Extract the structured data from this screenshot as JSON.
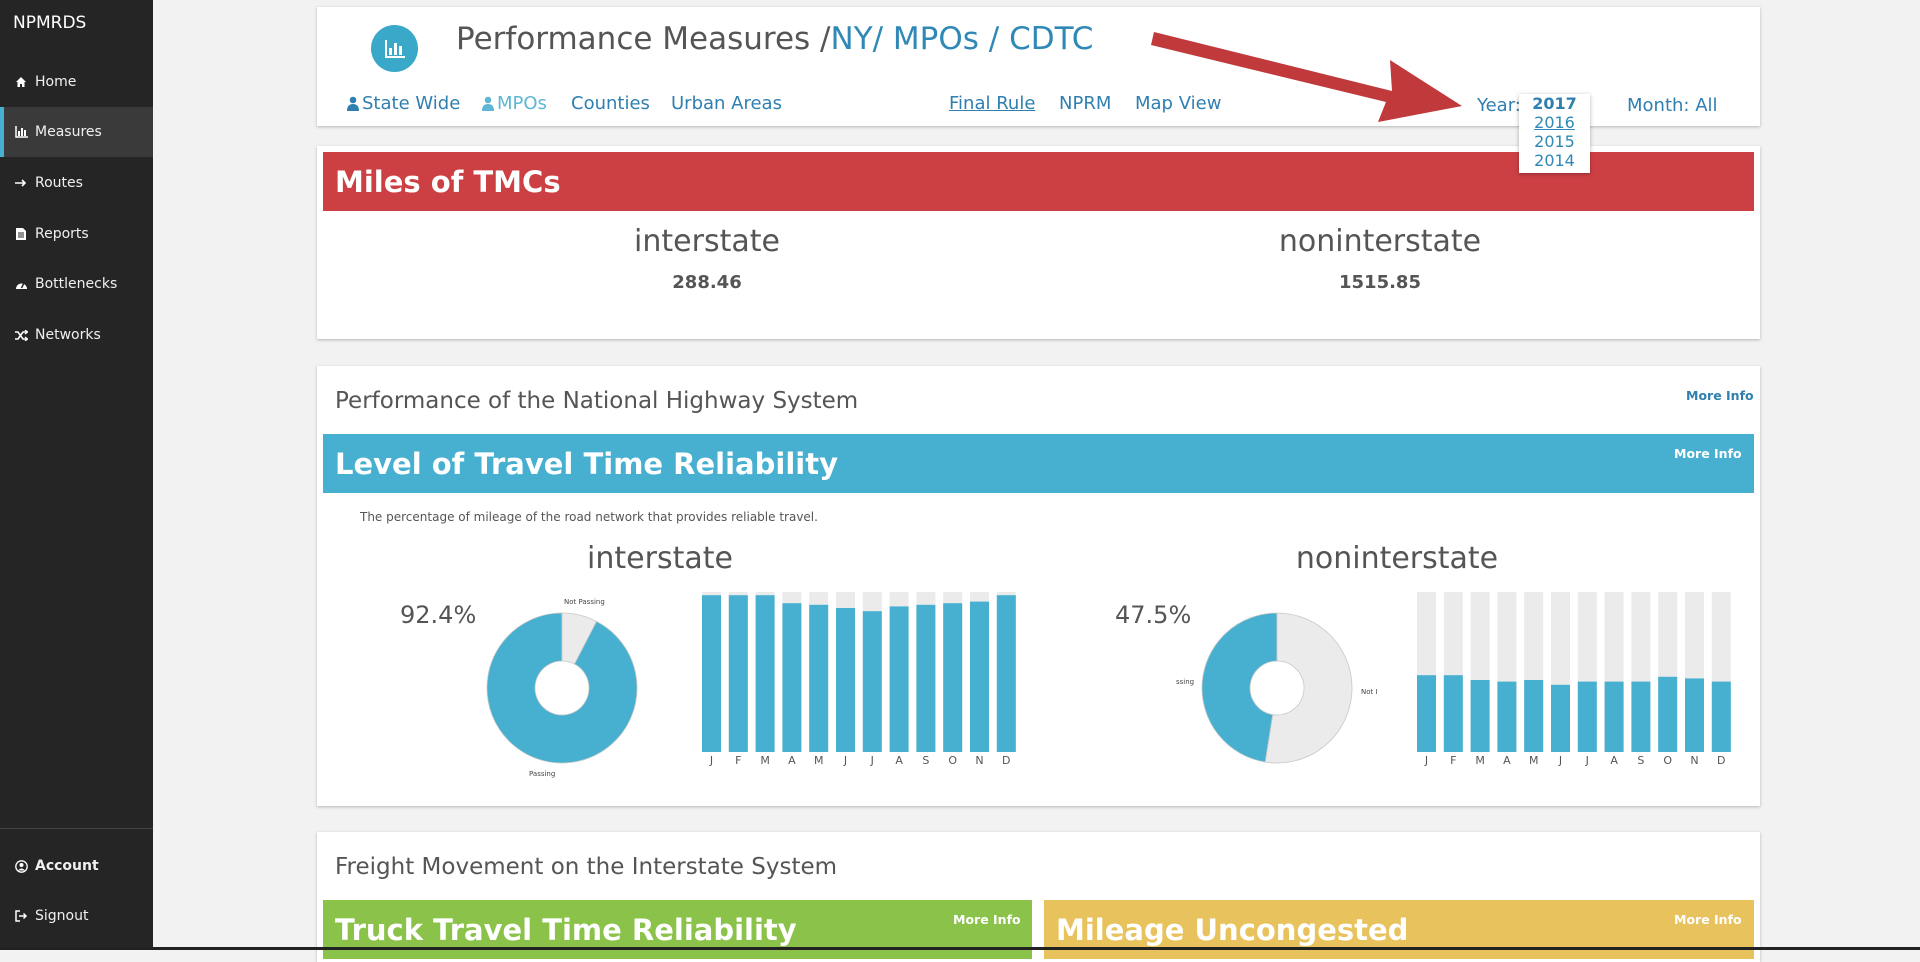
{
  "app": {
    "brand": "NPMRDS"
  },
  "sidebar": {
    "items": [
      {
        "label": "Home",
        "icon": "home-icon"
      },
      {
        "label": "Measures",
        "icon": "bar-chart-icon"
      },
      {
        "label": "Routes",
        "icon": "arrow-right-icon"
      },
      {
        "label": "Reports",
        "icon": "document-icon"
      },
      {
        "label": "Bottlenecks",
        "icon": "dashboard-icon"
      },
      {
        "label": "Networks",
        "icon": "shuffle-icon"
      }
    ],
    "bottom": [
      {
        "label": "Account",
        "icon": "user-circle-icon"
      },
      {
        "label": "Signout",
        "icon": "sign-out-icon"
      }
    ]
  },
  "header": {
    "title_prefix": "Performance Measures /",
    "crumb": "NY/ MPOs / CDTC",
    "links": {
      "state_wide": "State Wide",
      "mpos": "MPOs",
      "counties": "Counties",
      "urban_areas": "Urban Areas",
      "final_rule": "Final Rule",
      "nprm": "NPRM",
      "map_view": "Map View"
    },
    "year_label": "Year:",
    "month_label": "Month: All",
    "years": [
      "2017",
      "2016",
      "2015",
      "2014"
    ],
    "selected_year": "2017"
  },
  "miles": {
    "title": "Miles of TMCs",
    "interstate_label": "interstate",
    "interstate_value": "288.46",
    "noninterstate_label": "noninterstate",
    "noninterstate_value": "1515.85"
  },
  "nhs": {
    "title": "Performance of the National Highway System",
    "more_info": "More Info",
    "lottr": {
      "title": "Level of Travel Time Reliability",
      "more_info": "More Info",
      "description": "The percentage of mileage of the road network that provides reliable travel.",
      "interstate": {
        "label": "interstate",
        "percent": "92.4%",
        "pie_labels": {
          "top": "Not Passing",
          "bottom": "Passing"
        },
        "passing_fraction": 0.924,
        "months": [
          "J",
          "F",
          "M",
          "A",
          "M",
          "J",
          "J",
          "A",
          "S",
          "O",
          "N",
          "D"
        ],
        "monthly_pct": [
          98,
          98,
          98,
          93,
          92,
          90,
          88,
          91,
          92,
          93,
          94,
          98
        ]
      },
      "noninterstate": {
        "label": "noninterstate",
        "percent": "47.5%",
        "pie_labels": {
          "left": "ssing",
          "right": "Not I"
        },
        "passing_fraction": 0.475,
        "months": [
          "J",
          "F",
          "M",
          "A",
          "M",
          "J",
          "J",
          "A",
          "S",
          "O",
          "N",
          "D"
        ],
        "monthly_pct": [
          48,
          48,
          45,
          44,
          45,
          42,
          44,
          44,
          44,
          47,
          46,
          44
        ]
      }
    }
  },
  "freight": {
    "title": "Freight Movement on the Interstate System",
    "truck": {
      "title": "Truck Travel Time Reliability",
      "more_info": "More Info"
    },
    "mileage": {
      "title": "Mileage Uncongested",
      "more_info": "More Info"
    }
  },
  "colors": {
    "sidebar": "#252525",
    "accent": "#47b0d0",
    "red": "#cc4044",
    "green": "#8bc34a",
    "yellow": "#e8c25c",
    "link": "#2f7fb0",
    "bar_bg": "#ebebeb"
  }
}
